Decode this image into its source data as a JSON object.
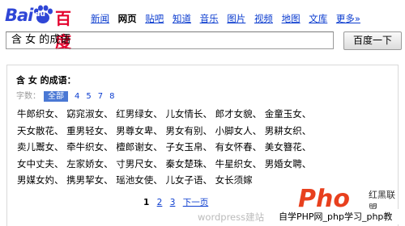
{
  "logo": {
    "bai": "Bai",
    "du": "du",
    "baike": "百度"
  },
  "nav": [
    {
      "label": "新闻"
    },
    {
      "label": "网页",
      "active": true
    },
    {
      "label": "贴吧"
    },
    {
      "label": "知道"
    },
    {
      "label": "音乐"
    },
    {
      "label": "图片"
    },
    {
      "label": "视频"
    },
    {
      "label": "地图"
    },
    {
      "label": "文库"
    },
    {
      "label": "更多»"
    }
  ],
  "search": {
    "value": "含 女 的成语",
    "button": "百度一下"
  },
  "result": {
    "title": "含 女 的成语：",
    "count_label": "字数：",
    "count_options": [
      "全部",
      "4",
      "5",
      "7",
      "8"
    ],
    "rows": [
      "牛郎织女、 窈窕淑女、 红男绿女、 儿女情长、 郎才女貌、 金童玉女、",
      "天女散花、 重男轻女、 男尊女卑、 男女有别、 小脚女人、 男耕女织、",
      "卖儿鬻女、 牵牛织女、 檀郎谢女、 子女玉帛、 有女怀春、 美女簪花、",
      "女中丈夫、 左家娇女、 寸男尺女、 秦女楚珠、 牛星织女、 男婚女聘、",
      "男媒女妁、 携男挈女、 瑶池女使、 儿女子语、 女长须嫁"
    ],
    "pager": [
      {
        "label": "1",
        "current": true
      },
      {
        "label": "2"
      },
      {
        "label": "3"
      },
      {
        "label": "下一页"
      }
    ]
  },
  "watermarks": {
    "wordpress": "wordpress建站",
    "php_big": "Pℎo",
    "php_small": "红黑联盟",
    "php_bar": "自学PHP网_php学习_php教"
  },
  "colors": {
    "link": "#0b3ccf",
    "baidu_blue": "#2f46d6",
    "baidu_red": "#e4032e"
  }
}
